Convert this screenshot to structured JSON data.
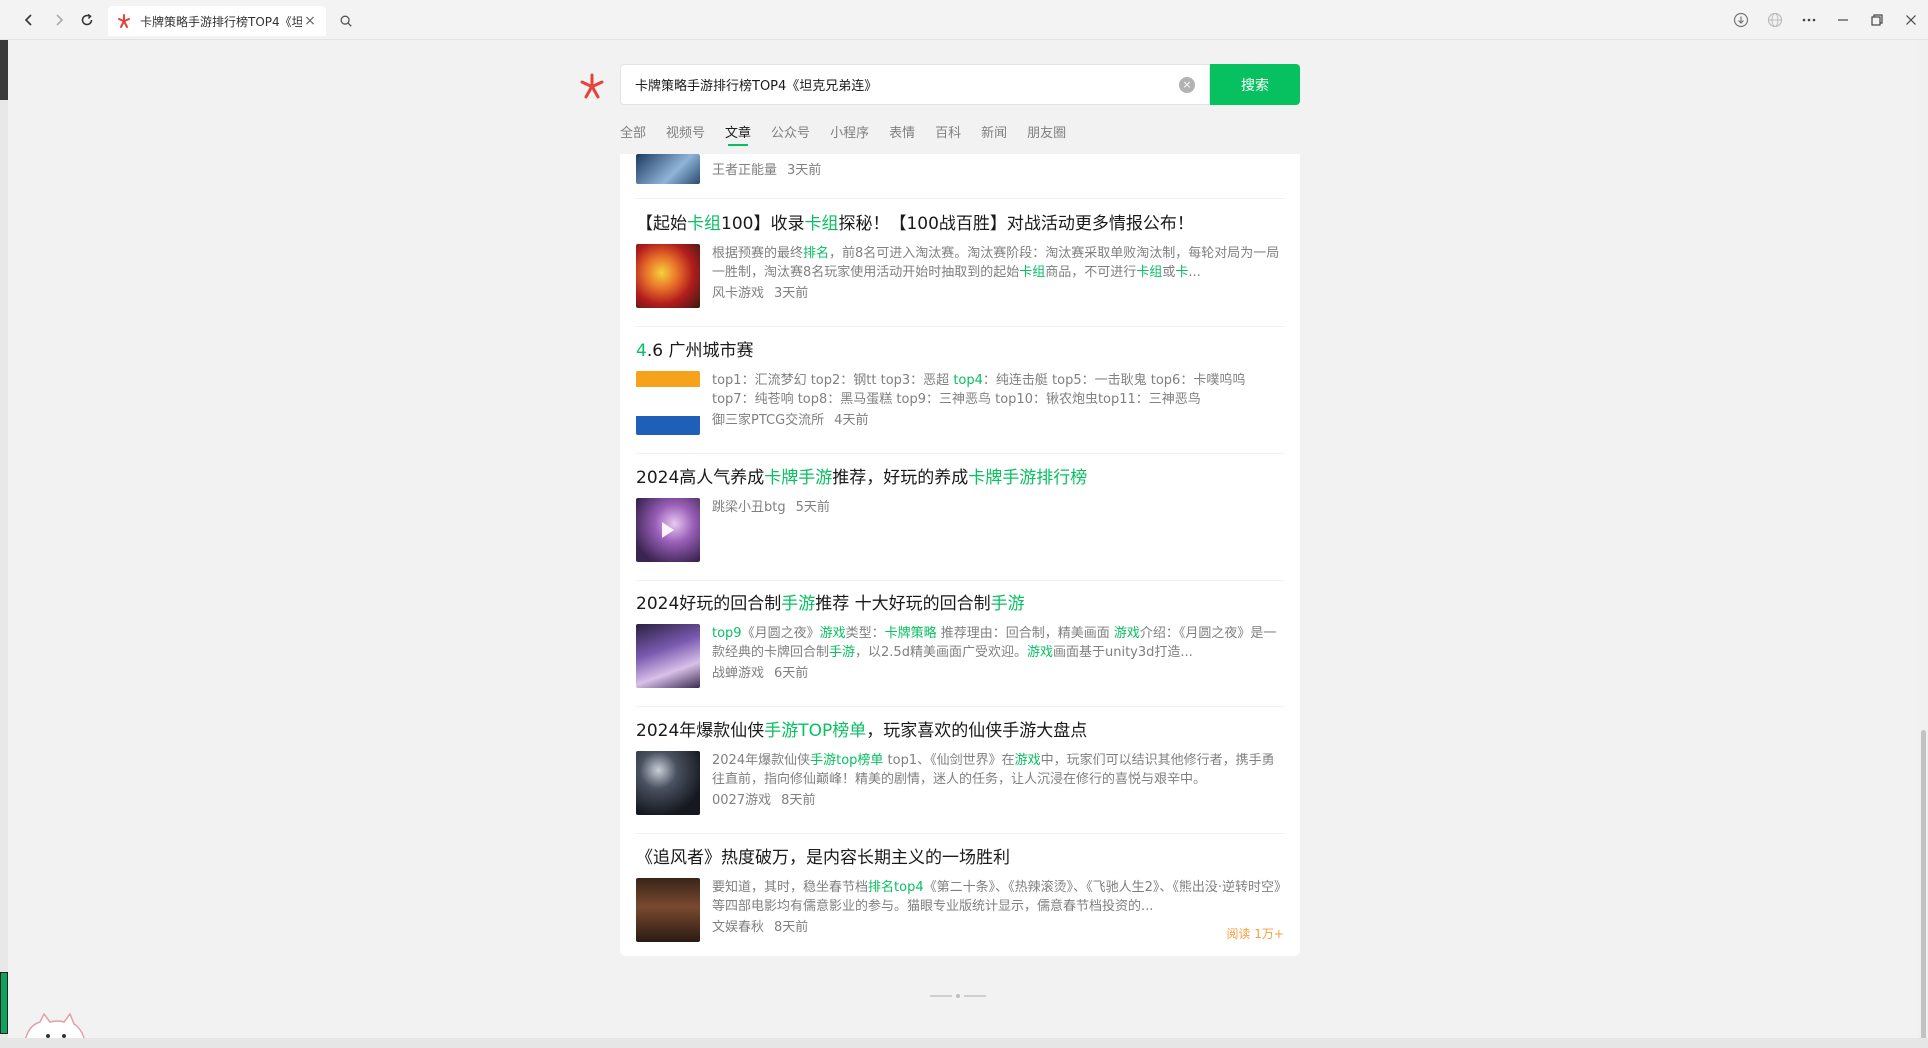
{
  "browser": {
    "tab_title": "卡牌策略手游排行榜TOP4《坦",
    "tab_close": "×"
  },
  "search": {
    "query": "卡牌策略手游排行榜TOP4《坦克兄弟连》",
    "button_label": "搜索"
  },
  "tabs": [
    {
      "label": "全部",
      "active": false
    },
    {
      "label": "视频号",
      "active": false
    },
    {
      "label": "文章",
      "active": true
    },
    {
      "label": "公众号",
      "active": false
    },
    {
      "label": "小程序",
      "active": false
    },
    {
      "label": "表情",
      "active": false
    },
    {
      "label": "百科",
      "active": false
    },
    {
      "label": "新闻",
      "active": false
    },
    {
      "label": "朋友圈",
      "active": false
    }
  ],
  "results": {
    "partial": {
      "source": "王者正能量",
      "time": "3天前"
    },
    "items": [
      {
        "title_parts": [
          "【起始",
          "卡组",
          "100】收录",
          "卡组",
          "探秘！【100战百胜】对战活动更多情报公布！"
        ],
        "desc_parts": [
          "根据预赛的最终",
          "排名",
          "，前8名可进入淘汰赛。淘汰赛阶段：淘汰赛采取单败淘汰制，每轮对局为一局一胜制，淘汰赛8名玩家使用活动开始时抽取到的起始",
          "卡组",
          "商品，不可进行",
          "卡组",
          "或",
          "卡",
          "..."
        ],
        "source": "风卡游戏",
        "time": "3天前"
      },
      {
        "title_parts": [
          "4",
          ".6 广州城市赛"
        ],
        "desc_parts": [
          "top1：汇流梦幻 top2：钢tt top3：恶超 ",
          "top4",
          "：纯连击艇 top5：一击耿鬼 top6：卡噗呜呜 top7：纯苍响 top8：黑马蛋糕 top9：三神恶鸟 top10：锹农炮虫top11：三神恶鸟"
        ],
        "source": "御三家PTCG交流所",
        "time": "4天前"
      },
      {
        "title_parts": [
          "2024高人气养成",
          "卡牌手游",
          "推荐，好玩的养成",
          "卡牌手游排行榜"
        ],
        "desc_parts": [],
        "source": "跳梁小丑btg",
        "time": "5天前"
      },
      {
        "title_parts": [
          "2024好玩的回合制",
          "手游",
          "推荐 十大好玩的回合制",
          "手游"
        ],
        "desc_parts": [
          "top9",
          "《月圆之夜》",
          "游戏",
          "类型：",
          "卡牌策略",
          " 推荐理由：回合制，精美画面 ",
          "游戏",
          "介绍：《月圆之夜》是一款经典的卡牌回合制",
          "手游",
          "，以2.5d精美画面广受欢迎。",
          "游戏",
          "画面基于unity3d打造..."
        ],
        "source": "战蝉游戏",
        "time": "6天前"
      },
      {
        "title_parts": [
          "2024年爆款仙侠",
          "手游TOP榜单",
          "，玩家喜欢的仙侠手游大盘点"
        ],
        "desc_parts": [
          "2024年爆款仙侠",
          "手游top榜单",
          " top1、《仙剑世界》在",
          "游戏",
          "中，玩家们可以结识其他修行者，携手勇往直前，指向修仙巅峰！精美的剧情，迷人的任务，让人沉浸在修行的喜悦与艰辛中。"
        ],
        "source": "0027游戏",
        "time": "8天前"
      },
      {
        "title_parts": [
          "《追风者》热度破万，是内容长期主义的一场胜利"
        ],
        "desc_parts": [
          "要知道，其时，稳坐春节档",
          "排名top4",
          "《第二十条》、《热辣滚烫》、《飞驰人生2》、《熊出没·逆转时空》等四部电影均有儒意影业的参与。猫眼专业版统计显示，儒意春节档投资的..."
        ],
        "source": "文娱春秋",
        "time": "8天前",
        "reads": "阅读 1万+"
      }
    ]
  },
  "colors": {
    "accent": "#07c160",
    "reads": "#fa9d3b",
    "muted": "#808080"
  }
}
